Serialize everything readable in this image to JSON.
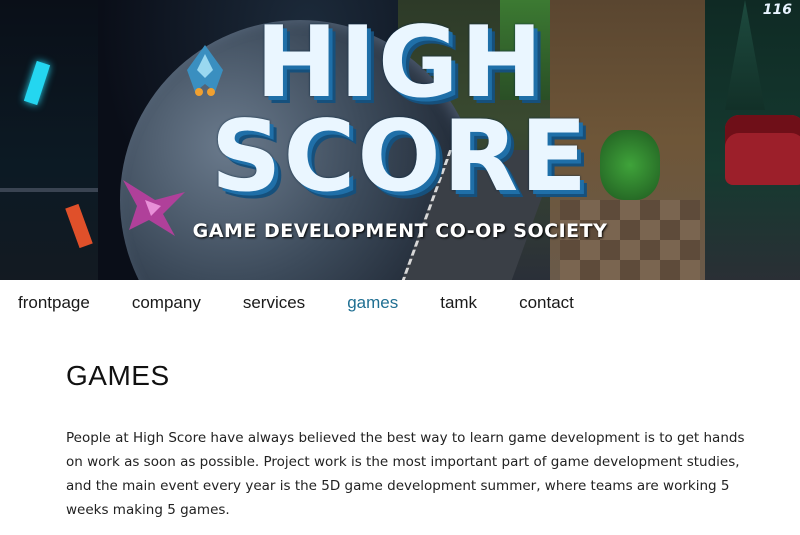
{
  "banner": {
    "logo_line1": "HIGH",
    "logo_line2": "SCORE",
    "subtitle": "GAME DEVELOPMENT CO-OP SOCIETY",
    "hud_text": "116"
  },
  "nav": {
    "items": [
      {
        "label": "frontpage"
      },
      {
        "label": "company"
      },
      {
        "label": "services"
      },
      {
        "label": "games",
        "active": true
      },
      {
        "label": "tamk"
      },
      {
        "label": "contact"
      }
    ],
    "active_color": "#1f6f92"
  },
  "page": {
    "title": "GAMES",
    "intro": "People at High Score have always believed the best way to learn game development is to get hands on work as soon as possible. Project work is the most important part of game development studies, and the main event every year is the 5D game development summer, where teams are working 5 weeks making 5 games."
  }
}
